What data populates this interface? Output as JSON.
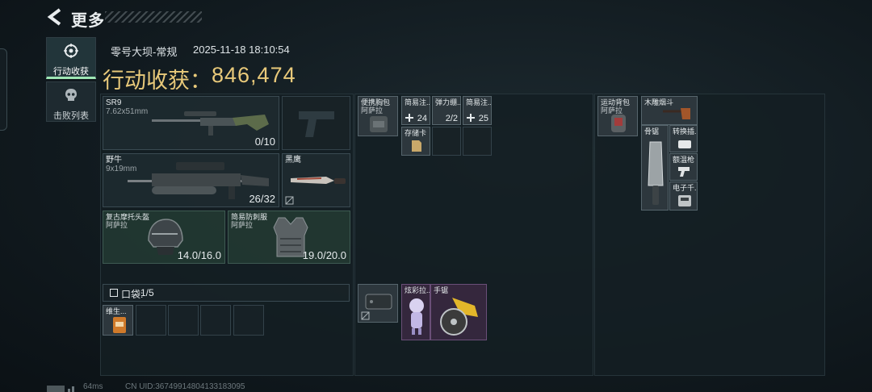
{
  "header": {
    "title": "更多"
  },
  "tabs": [
    {
      "label": "行动收获",
      "active": true
    },
    {
      "label": "击败列表",
      "active": false
    }
  ],
  "record": {
    "mode": "零号大坝-常规",
    "time": "2025-11-18 18:10:54",
    "haul_label": "行动收获：",
    "haul_value": "846,474"
  },
  "weapons": {
    "primary": {
      "name": "SR9",
      "ammo": "7.62x51mm",
      "capacity": "0/10"
    },
    "secondary": {
      "name": "野牛",
      "ammo": "9x19mm",
      "capacity": "26/32"
    },
    "melee": {
      "name": "黑鹰"
    }
  },
  "armor": {
    "helmet": {
      "name": "复古摩托头盔",
      "map": "阿萨拉",
      "durability": "14.0/16.0"
    },
    "vest": {
      "name": "简易防刺服",
      "map": "阿萨拉",
      "durability": "19.0/20.0"
    }
  },
  "pocket": {
    "label": "口袋:",
    "count": "1/5",
    "items": [
      {
        "name": "维生..."
      }
    ]
  },
  "chest_rig": {
    "name": "便携胸包",
    "map": "阿萨拉",
    "items": [
      {
        "name": "简易注...",
        "count": "24"
      },
      {
        "name": "弹力绷...",
        "count": "2/2"
      },
      {
        "name": "简易注...",
        "count": "25"
      },
      {
        "name": "存储卡"
      }
    ]
  },
  "safe_box": {
    "items": [
      {
        "name": "炫彩拉..."
      },
      {
        "name": "手锯"
      }
    ]
  },
  "backpack": {
    "name": "运动背包",
    "map": "阿萨拉",
    "items": [
      {
        "name": "木雕烟斗"
      },
      {
        "name": "骨锯"
      },
      {
        "name": "转换插..."
      },
      {
        "name": "额温枪"
      },
      {
        "name": "电子千..."
      }
    ]
  },
  "footer": {
    "ping": "64ms",
    "uid": "CN UID:36749914804133183095"
  },
  "colors": {
    "accent_gold": "#e8c97a",
    "active_tab_underline": "#9ee6b4"
  }
}
